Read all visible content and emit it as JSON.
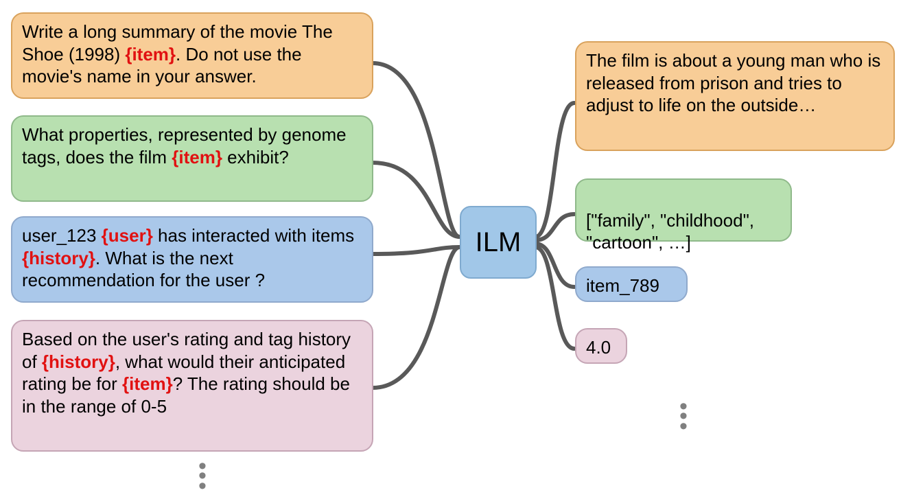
{
  "center": {
    "label": "ILM"
  },
  "inputs": {
    "summary": {
      "t1": "Write a long summary of the movie The Shoe (1998) ",
      "tok": "{item}",
      "t2": ". Do not use the movie's name in your answer."
    },
    "props": {
      "t1": "What properties, represented by genome tags, does the film ",
      "tok": "{item}",
      "t2": " exhibit?"
    },
    "rec": {
      "t1": "user_123 ",
      "tok1": "{user}",
      "t2": " has interacted with items ",
      "tok2": "{history}",
      "t3": ". What is the next recommendation for the user ?"
    },
    "rating": {
      "t1": "Based on the user's rating and tag history of ",
      "tok1": "{history}",
      "t2": ", what would their anticipated rating be for ",
      "tok2": "{item}",
      "t3": "? The rating should be in the range of 0-5"
    }
  },
  "outputs": {
    "summary": "The film is about a young man who is released from prison and tries to adjust to life on the outside…",
    "props": "[\"family\", \"childhood\",\n \"cartoon\", …]",
    "rec": "item_789",
    "rating": "4.0"
  }
}
